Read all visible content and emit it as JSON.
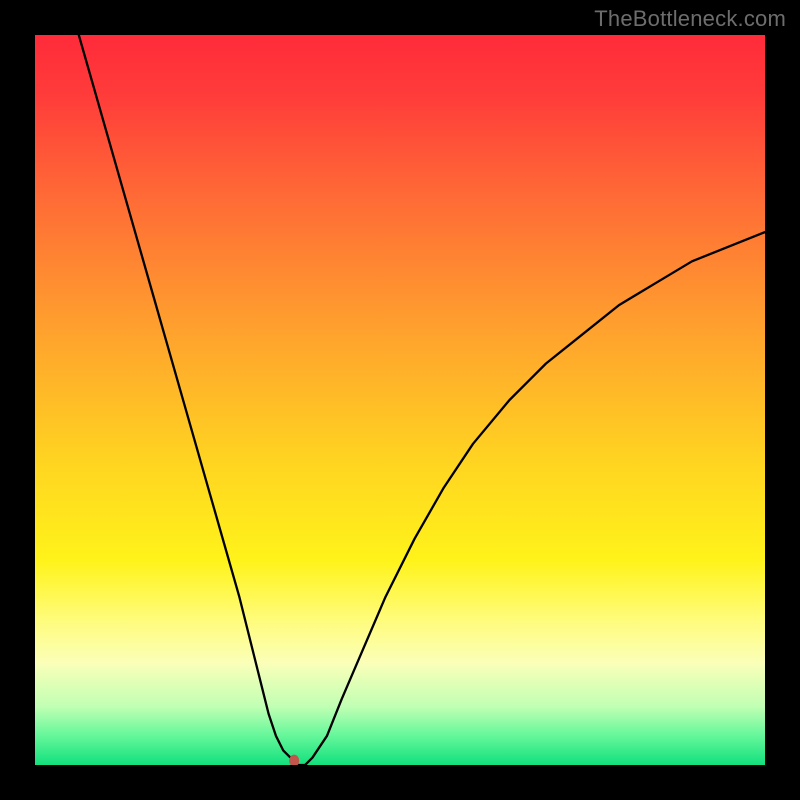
{
  "watermark": "TheBottleneck.com",
  "chart_data": {
    "type": "line",
    "title": "",
    "xlabel": "",
    "ylabel": "",
    "xlim": [
      0,
      100
    ],
    "ylim": [
      0,
      100
    ],
    "grid": false,
    "gradient_stops": [
      {
        "offset": 0,
        "color": "#ff2b3a"
      },
      {
        "offset": 0.08,
        "color": "#ff3b3a"
      },
      {
        "offset": 0.22,
        "color": "#ff6a36"
      },
      {
        "offset": 0.4,
        "color": "#ffa02e"
      },
      {
        "offset": 0.58,
        "color": "#ffd321"
      },
      {
        "offset": 0.72,
        "color": "#fff31a"
      },
      {
        "offset": 0.8,
        "color": "#fffc7a"
      },
      {
        "offset": 0.86,
        "color": "#fbffb8"
      },
      {
        "offset": 0.92,
        "color": "#c0ffb4"
      },
      {
        "offset": 0.96,
        "color": "#64f79a"
      },
      {
        "offset": 1.0,
        "color": "#12e07d"
      }
    ],
    "series": [
      {
        "name": "curve",
        "stroke": "#000000",
        "stroke_width": 2.3,
        "x": [
          6,
          8,
          10,
          12,
          14,
          16,
          18,
          20,
          22,
          24,
          26,
          28,
          30,
          31,
          32,
          33,
          34,
          35,
          36,
          37,
          38,
          40,
          42,
          45,
          48,
          52,
          56,
          60,
          65,
          70,
          75,
          80,
          85,
          90,
          95,
          100
        ],
        "y": [
          100,
          93,
          86,
          79,
          72,
          65,
          58,
          51,
          44,
          37,
          30,
          23,
          15,
          11,
          7,
          4,
          2,
          1,
          0,
          0,
          1,
          4,
          9,
          16,
          23,
          31,
          38,
          44,
          50,
          55,
          59,
          63,
          66,
          69,
          71,
          73
        ]
      }
    ],
    "marker": {
      "x": 35.5,
      "y": 0.6,
      "rx": 5,
      "ry": 6,
      "fill": "#c2564c"
    }
  }
}
